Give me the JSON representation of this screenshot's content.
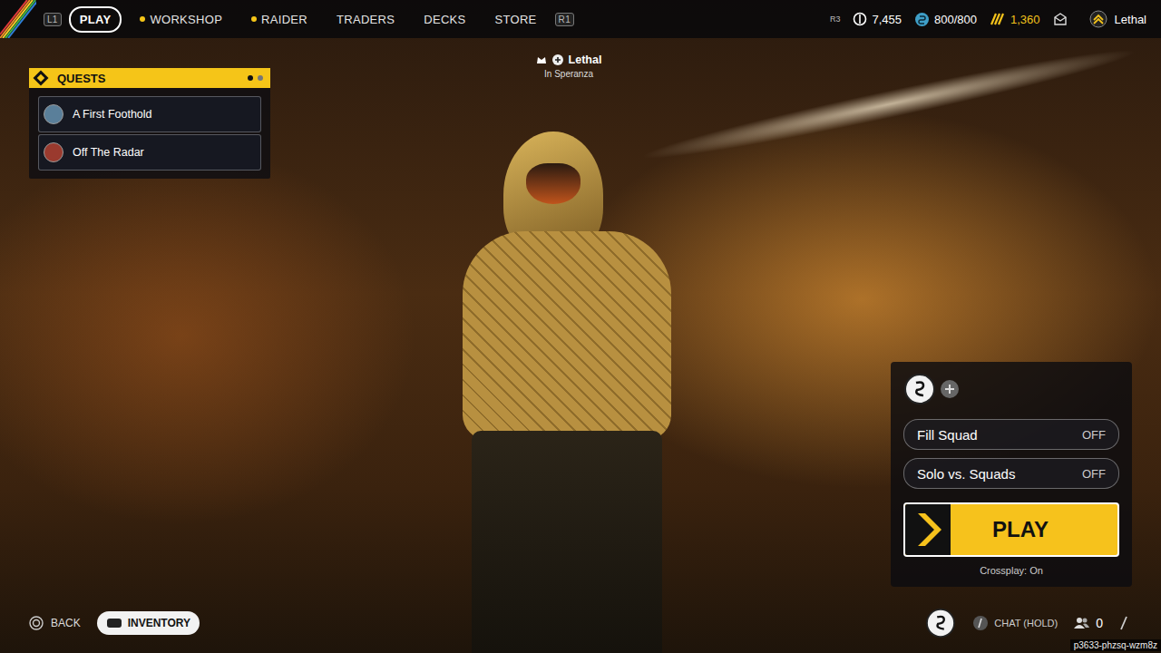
{
  "top_nav": {
    "left_key": "L1",
    "right_key": "R1",
    "tabs": [
      {
        "label": "PLAY",
        "selected": true,
        "dot": false
      },
      {
        "label": "WORKSHOP",
        "selected": false,
        "dot": true
      },
      {
        "label": "RAIDER",
        "selected": false,
        "dot": true
      },
      {
        "label": "TRADERS",
        "selected": false,
        "dot": false
      },
      {
        "label": "DECKS",
        "selected": false,
        "dot": false
      },
      {
        "label": "STORE",
        "selected": false,
        "dot": false
      }
    ]
  },
  "currencies": {
    "key": "R3",
    "items": [
      {
        "kind": "coins",
        "value": "7,455"
      },
      {
        "kind": "creds",
        "value": "800/800"
      },
      {
        "kind": "tokens",
        "value": "1,360"
      }
    ]
  },
  "profile": {
    "name": "Lethal"
  },
  "quests": {
    "title": "QUESTS",
    "pages": [
      {
        "selected": true
      },
      {
        "selected": false
      }
    ],
    "items": [
      {
        "label": "A First Foothold",
        "color": "#5a7f9a"
      },
      {
        "label": "Off The Radar",
        "color": "#9a3a2e"
      }
    ]
  },
  "player_tag": {
    "name": "Lethal",
    "location": "In Speranza"
  },
  "squad_panel": {
    "toggles": [
      {
        "label": "Fill Squad",
        "value": "OFF",
        "on": false
      },
      {
        "label": "Solo vs. Squads",
        "value": "OFF",
        "on": false
      }
    ],
    "play_button": "PLAY",
    "crossplay": "Crossplay: On"
  },
  "bottom_bar": {
    "back": "BACK",
    "inventory": "INVENTORY",
    "chat": "CHAT (HOLD)",
    "friends_count": "0",
    "session_code": "p3633-phzsq-wzm8z"
  }
}
